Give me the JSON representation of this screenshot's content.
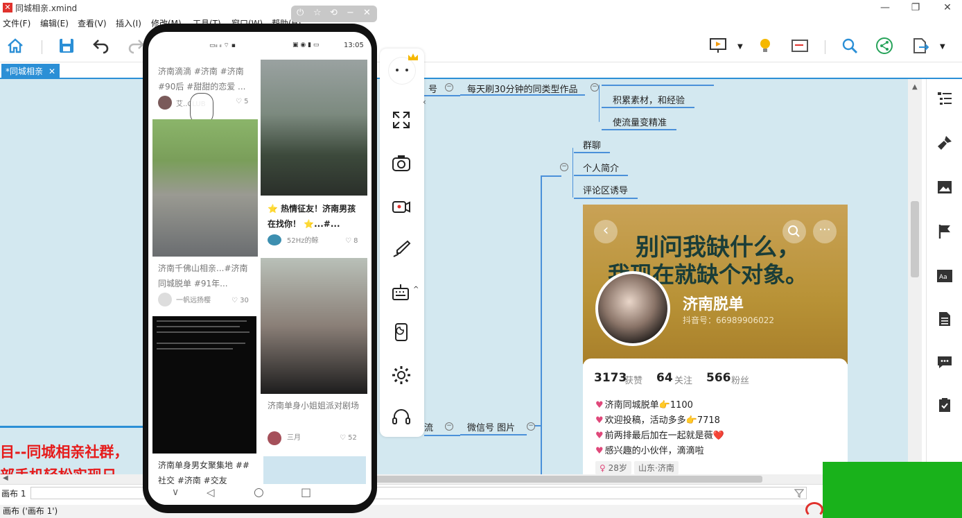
{
  "window": {
    "title": "同城相亲.xmind",
    "minimize": "—",
    "restore": "❐",
    "close": "✕"
  },
  "menu": [
    "文件(F)",
    "编辑(E)",
    "查看(V)",
    "插入(I)",
    "修改(M)",
    "工具(T)",
    "窗口(W)",
    "帮助(H)"
  ],
  "tab": {
    "label": "*同城相亲",
    "close": "✕"
  },
  "mindmap": {
    "node_partial_left": "号",
    "node_daily": "每天刷30分钟的同类型作品",
    "node_accumulate": "积累素材，和经验",
    "node_precise": "使流量变精准",
    "node_group": "群聊",
    "node_profile": "个人简介",
    "node_comment": "评论区诱导",
    "node_flow": "流",
    "node_wechat": "微信号 图片"
  },
  "profile_card": {
    "headline_line1": "别问我缺什么，",
    "headline_line2": "我现在就缺个对象。",
    "name": "济南脱单",
    "douyin_id": "抖音号：66989906022",
    "stats": [
      {
        "num": "3173",
        "label": "获赞"
      },
      {
        "num": "64",
        "label": "关注"
      },
      {
        "num": "566",
        "label": "粉丝"
      }
    ],
    "bio": [
      "济南同城脱单👉1100",
      "欢迎投稿，活动多多👉7718",
      "前两排最后加在一起就是薇❤️",
      "感兴趣的小伙伴，滴滴啦"
    ],
    "tags": [
      "28岁",
      "山东·济南"
    ]
  },
  "phone": {
    "status_time": "13:05",
    "feed_left": [
      {
        "title": "济南滴滴 #济南 #济南 #90后 #甜甜的恋爱 ...",
        "author": "艾..CLUB",
        "likes": "5"
      },
      {
        "title": "济南千佛山相亲...#济南同城脱单 #91年...",
        "author": "一帆远扬樱",
        "likes": "30"
      },
      {
        "title": "济南单身男女聚集地 ##社交 #济南 #交友",
        "author": "",
        "likes": ""
      }
    ],
    "feed_right": [
      {
        "title": "⭐ 热情征友！济南男孩在找你！ ⭐...#...",
        "author": "52Hz的鲸",
        "likes": "8"
      },
      {
        "title": "济南单身小姐姐派对剧场",
        "author": "三月",
        "likes": "52"
      }
    ],
    "nav": [
      "∨",
      "◁",
      "○",
      "□"
    ]
  },
  "red_caption_line1": "目--同城相亲社群，",
  "red_caption_line2": "部手机轻松实现日",
  "status": {
    "sheet_tab": "画布 1",
    "bottom": "画布 ('画布 1')"
  },
  "colors": {
    "accent": "#2b8fd6",
    "canvas": "#d3e8f0",
    "caption_red": "#e61b1b",
    "overlay_green": "#19b21b"
  }
}
